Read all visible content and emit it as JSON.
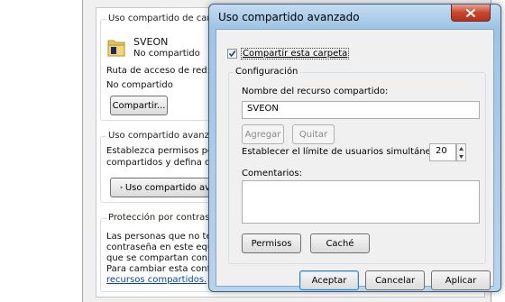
{
  "background_dialog": {
    "sharing_group_title": "Uso compartido de carpeta",
    "folder_name": "SVEON",
    "folder_status": "No compartido",
    "network_path_label": "Ruta de acceso de red:",
    "network_path_value": "No compartido",
    "share_button": "Compartir...",
    "advanced_group_title": "Uso compartido avanzado",
    "advanced_desc_line1": "Establezca permisos perso",
    "advanced_desc_line2": "compartidos y defina otras",
    "advanced_button": "Uso compartido av",
    "password_group_title": "Protección por contraseña",
    "password_line1": "Las personas que no tenga",
    "password_line2": "contraseña en este equipo",
    "password_line3": "que se compartan con todo",
    "password_line4": "Para cambiar esta configura",
    "password_link": "recursos compartidos."
  },
  "advanced_dialog": {
    "title": "Uso compartido avanzado",
    "share_checkbox_label": "Compartir esta carpeta",
    "share_checkbox_checked": true,
    "config_legend": "Configuración",
    "share_name_label": "Nombre del recurso compartido:",
    "share_name_value": "SVEON",
    "add_button": "Agregar",
    "remove_button": "Quitar",
    "user_limit_label": "Establecer el límite de usuarios simultáneos en:",
    "user_limit_value": "20",
    "comments_label": "Comentarios:",
    "comments_value": "",
    "permissions_button": "Permisos",
    "cache_button": "Caché",
    "ok_button": "Aceptar",
    "cancel_button": "Cancelar",
    "apply_button": "Aplicar"
  },
  "icons": {
    "close": "close-icon",
    "folder": "folder-icon",
    "shield": "shield-icon"
  },
  "colors": {
    "title_bar": "#9ec4e6",
    "close_button": "#c9452d",
    "link": "#0645ad"
  }
}
